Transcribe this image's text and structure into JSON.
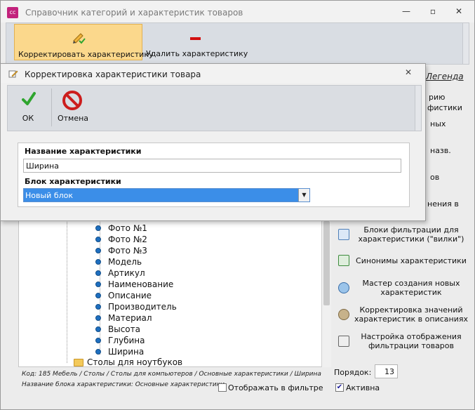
{
  "window": {
    "icon_text": "cc",
    "title": "Справочник категорий и характеристик товаров",
    "minimize": "—",
    "maximize": "▫",
    "close": "✕"
  },
  "ribbon": {
    "edit_label": "Корректировать характеристику",
    "delete_label": "Удалить характеристику"
  },
  "tree": {
    "items": [
      "Фото №1",
      "Фото №2",
      "Фото №3",
      "Модель",
      "Артикул",
      "Наименование",
      "Описание",
      "Производитель",
      "Материал",
      "Высота",
      "Глубина",
      "Ширина"
    ],
    "folder_label": "Столы для ноутбуков"
  },
  "status": {
    "code_line": "Код: 185       Мебель / Столы / Столы для компьютеров / Основные характеристики / Ширина",
    "block_line": "Название блока характеристики: Основные характеристики"
  },
  "right_panel": {
    "legend": "Легенда",
    "fragments": [
      "рию",
      "фистики",
      "ных",
      "назв.",
      "ов",
      "нения в"
    ],
    "items": [
      {
        "label": "Блоки фильтрации для характеристики (\"вилки\")",
        "icon": "table-icon"
      },
      {
        "label": "Синонимы характеристики",
        "icon": "hierarchy-icon"
      },
      {
        "label": "Мастер создания новых характеристик",
        "icon": "database-add-icon"
      },
      {
        "label": "Корректировка значений характеристик в описаниях",
        "icon": "database-edit-icon"
      },
      {
        "label": "Настройка отображения фильтрации товаров",
        "icon": "filter-settings-icon"
      }
    ],
    "order_label": "Порядок:",
    "order_value": "13",
    "active_label": "Активна",
    "active_checked": "✔"
  },
  "filter_checkbox": {
    "label": "Отображать в фильтре"
  },
  "dialog": {
    "title": "Корректировка характеристики товара",
    "close": "✕",
    "ok_label": "ОК",
    "cancel_label": "Отмена",
    "name_label": "Название характеристики",
    "name_value": "Ширина",
    "block_label": "Блок характеристики",
    "block_value": "Новый блок",
    "dropdown_arrow": "▼"
  },
  "colors": {
    "accent": "#3b8ee8",
    "ribbon_selected": "#fbd88c",
    "delete_red": "#d21010",
    "app_icon": "#c2227c"
  }
}
